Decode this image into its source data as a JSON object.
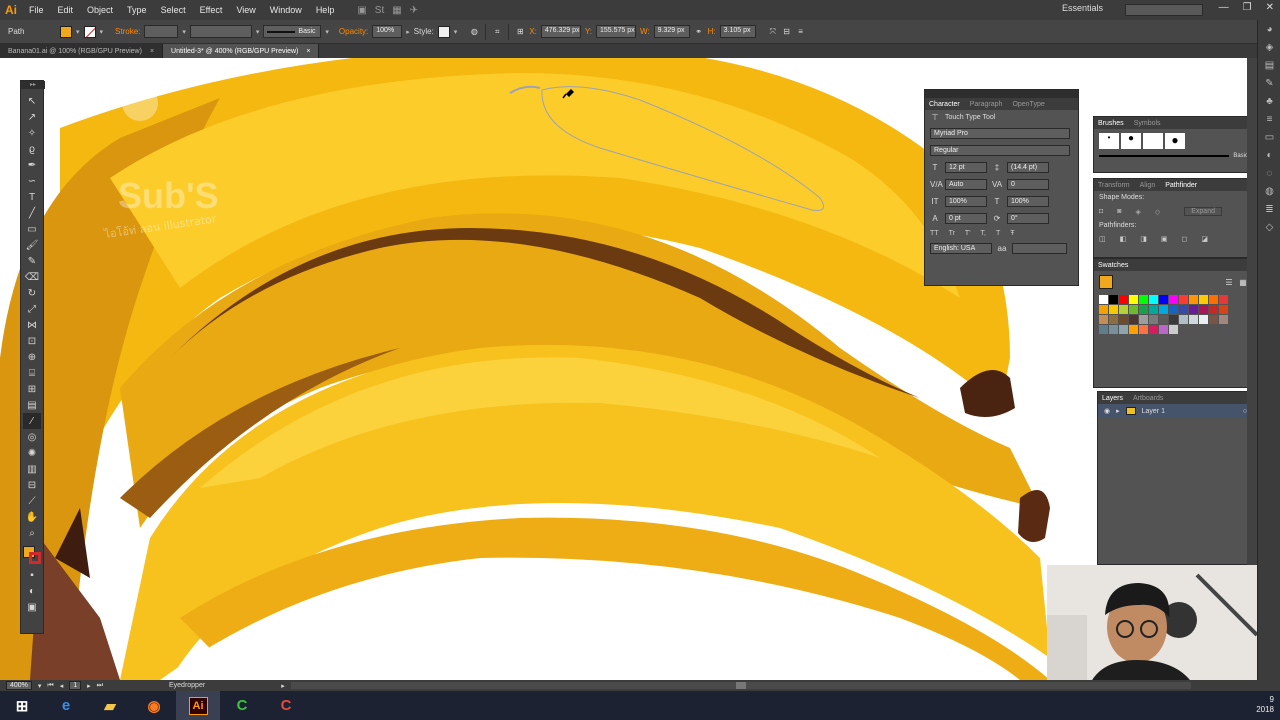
{
  "menubar": {
    "logo": "Ai",
    "items": [
      "File",
      "Edit",
      "Object",
      "Type",
      "Select",
      "Effect",
      "View",
      "Window",
      "Help"
    ],
    "workspace": "Essentials"
  },
  "control": {
    "selection": "Path",
    "stroke_label": "Stroke:",
    "brush": "Basic",
    "opacity_label": "Opacity:",
    "opacity": "100%",
    "style_label": "Style:",
    "x": "476.329 px",
    "y": "155.575 px",
    "w": "9.329 px",
    "h": "3.105 px",
    "fill_color": "#f0a81c",
    "stroke_color": "#d22a2a"
  },
  "tabs": [
    {
      "label": "Banana01.ai @ 100% (RGB/GPU Preview)"
    },
    {
      "label": "Untitled-3* @ 400% (RGB/GPU Preview)"
    }
  ],
  "character": {
    "tabs": [
      "Character",
      "Paragraph",
      "OpenType"
    ],
    "touch_type": "Touch Type Tool",
    "font": "Myriad Pro",
    "style": "Regular",
    "size": "12 pt",
    "leading": "(14.4 pt)",
    "kerning": "Auto",
    "tracking": "0",
    "vscale": "100%",
    "hscale": "100%",
    "baseline": "0 pt",
    "rotation": "0°",
    "language": "English: USA"
  },
  "brushes": {
    "tabs": [
      "Brushes",
      "Symbols"
    ],
    "preset": "Basic"
  },
  "pathfinder": {
    "tabs": [
      "Transform",
      "Align",
      "Pathfinder"
    ],
    "shape_modes": "Shape Modes:",
    "pathfinders": "Pathfinders:",
    "expand": "Expand"
  },
  "swatches": {
    "title": "Swatches",
    "colors": [
      "#ffffff",
      "#000000",
      "#ff0000",
      "#ffff00",
      "#00ff00",
      "#00ffff",
      "#0000ff",
      "#ff00ff",
      "#ff3b30",
      "#ff9500",
      "#ffcc00",
      "#ff6f00",
      "#e53935",
      "#f4a200",
      "#f7c900",
      "#b5d334",
      "#6fba2c",
      "#1ba04a",
      "#00a99d",
      "#00a8e0",
      "#1565c0",
      "#3949ab",
      "#6a1b9a",
      "#ad1457",
      "#c62828",
      "#d84315",
      "#c28e56",
      "#8d6e40",
      "#6d4c2c",
      "#4e342e",
      "#9e9e9e",
      "#7a7a7a",
      "#5a5a5a",
      "#3a3a3a",
      "#b0bec5",
      "#cfd8dc",
      "#eceff1",
      "#795548",
      "#a1887f",
      "#607d8b",
      "#78909c",
      "#90a4ae",
      "#ffa000",
      "#ff7043",
      "#d81b60",
      "#ba68c8",
      "#cccccc"
    ]
  },
  "layers": {
    "tabs": [
      "Layers",
      "Artboards"
    ],
    "items": [
      {
        "name": "Layer 1"
      }
    ]
  },
  "status": {
    "zoom": "400%",
    "page": "1",
    "tool": "Eyedropper"
  },
  "taskbar": {
    "apps": [
      "windows",
      "edge",
      "explorer",
      "firefox",
      "illustrator",
      "camtasia",
      "recorder"
    ],
    "clock": "9",
    "year": "2018"
  },
  "artwork": {
    "watermark": "Sub'S",
    "watermark_sub": "ไอโอ้ท่ ลอน illustrator"
  }
}
